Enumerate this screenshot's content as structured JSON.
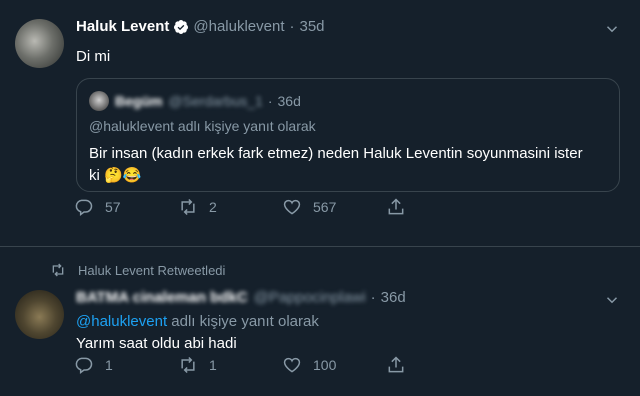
{
  "tweet1": {
    "author_name": "Haluk Levent",
    "handle": "@haluklevent",
    "separator": "·",
    "time": "35d",
    "text": "Di mi",
    "quote": {
      "author_name": "Begüm",
      "handle": "@Serdarbus_1",
      "separator": "·",
      "time": "36d",
      "reply_context": "@haluklevent adlı kişiye yanıt olarak",
      "text_line1": "Bir insan (kadın erkek fark etmez) neden Haluk Leventin soyunmasini ister",
      "text_line2": "ki 🤔😂"
    },
    "actions": {
      "replies": "57",
      "retweets": "2",
      "likes": "567"
    }
  },
  "tweet2": {
    "retweet_banner": "Haluk Levent Retweetledi",
    "author_name": "BATMA cinaleman bdkC",
    "handle": "@Pappocinplawi",
    "separator": "·",
    "time": "36d",
    "reply_mention": "@haluklevent",
    "reply_suffix": " adlı kişiye yanıt olarak",
    "text": "Yarım saat oldu abi hadi",
    "actions": {
      "replies": "1",
      "retweets": "1",
      "likes": "100"
    }
  },
  "colors": {
    "background": "#15202b",
    "muted": "#8899a6",
    "accent": "#1da1f2",
    "border": "#38444d"
  },
  "icons": [
    "verified-badge-icon",
    "chevron-down-icon",
    "reply-icon",
    "retweet-icon",
    "like-icon",
    "share-icon"
  ]
}
